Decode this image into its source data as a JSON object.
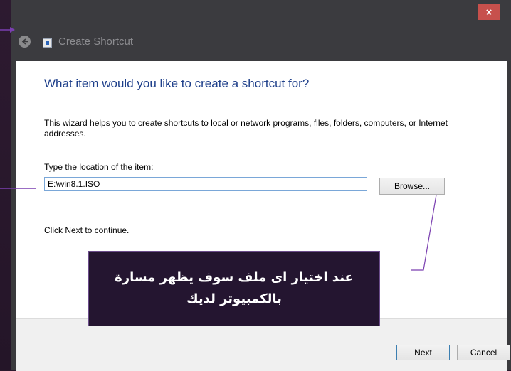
{
  "window": {
    "title": "Create Shortcut",
    "close_glyph": "×",
    "back_icon": "back-arrow-icon",
    "app_icon": "shortcut-icon"
  },
  "wizard": {
    "heading": "What item would you like to create a shortcut for?",
    "description": "This wizard helps you to create shortcuts to local or network programs, files, folders, computers, or Internet addresses.",
    "location_label": "Type the location of the item:",
    "location_value": "E:\\win8.1.ISO",
    "browse_label": "Browse...",
    "continue_text": "Click Next to continue."
  },
  "footer": {
    "next_label": "Next",
    "cancel_label": "Cancel"
  },
  "annotation": {
    "line1": "عند اختيار اى ملف سوف يظهر مسارة",
    "line2": "بالكمبيوتر لديك"
  },
  "colors": {
    "accent": "#1e3f8a",
    "annotation_line": "#7a3fb0",
    "close_button": "#c7504c",
    "callout_bg": "#241530"
  }
}
